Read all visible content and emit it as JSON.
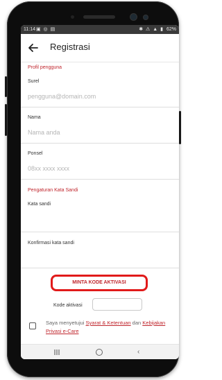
{
  "status_bar": {
    "time": "11:14",
    "notification_icons": "▣ ◎ ▤",
    "system_icons": "✱ ⚠ ▲ ▮",
    "battery": "62%"
  },
  "header": {
    "title": "Registrasi",
    "back_icon": "arrow-left-icon"
  },
  "profile_section": {
    "title": "Profil pengguna",
    "fields": [
      {
        "label": "Surel",
        "placeholder": "pengguna@domain.com"
      },
      {
        "label": "Nama",
        "placeholder": "Nama anda"
      },
      {
        "label": "Ponsel",
        "placeholder": "08xx xxxx xxxx"
      }
    ]
  },
  "password_section": {
    "title": "Pengaturan Kata Sandi",
    "fields": [
      {
        "label": "Kata sandi",
        "placeholder": ""
      },
      {
        "label": "Konfirmasi kata sandi",
        "placeholder": ""
      }
    ]
  },
  "activation": {
    "button_label": "MINTA KODE AKTIVASI",
    "code_label": "Kode aktivasi",
    "code_value": ""
  },
  "consent": {
    "prefix": "Saya menyetujui ",
    "terms_link": "Syarat & Ketentuan",
    "middle": " dan ",
    "privacy_link": "Kebijakan Privasi e-Care",
    "checked": false
  },
  "nav_bar": {
    "recent_icon": "recent-apps-icon",
    "home_icon": "home-icon",
    "back_icon": "back-icon",
    "back_glyph": "‹"
  },
  "colors": {
    "accent": "#c0262d",
    "highlight": "#e11a1a",
    "status_bar": "#3a3a3a",
    "phone_frame": "#0d0d0d"
  }
}
